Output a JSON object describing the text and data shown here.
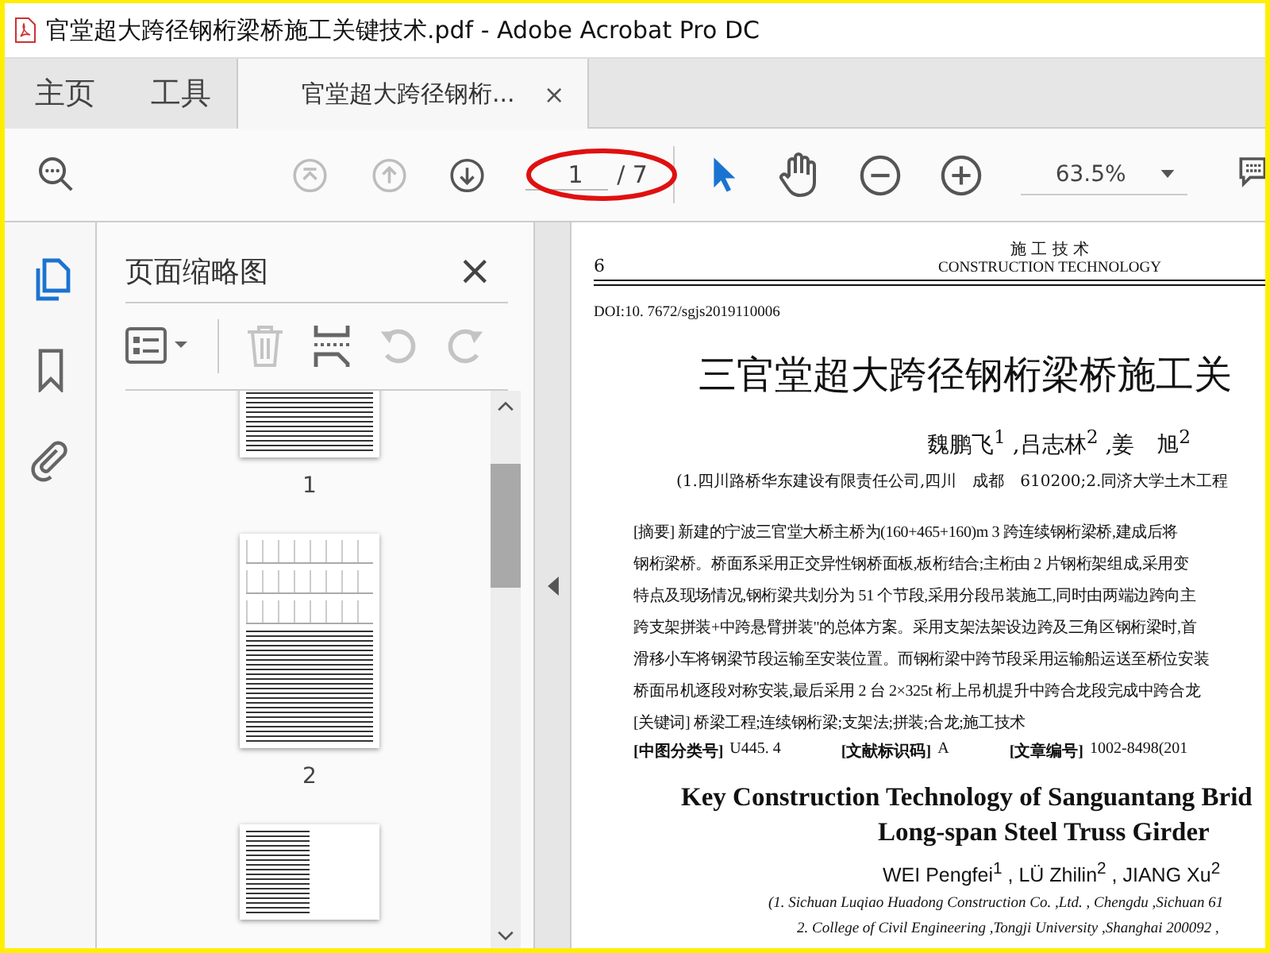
{
  "window": {
    "title": "官堂超大跨径钢桁梁桥施工关键技术.pdf - Adobe Acrobat Pro DC"
  },
  "tabs": [
    {
      "label": "主页",
      "selected": false,
      "kind": "nav"
    },
    {
      "label": "工具",
      "selected": false,
      "kind": "nav"
    },
    {
      "label": "官堂超大跨径钢桁...",
      "selected": true,
      "kind": "document",
      "close": "×"
    }
  ],
  "toolbar": {
    "buttons": [
      {
        "kind": "search"
      },
      {
        "kind": "first",
        "disabled": true
      },
      {
        "kind": "prev",
        "disabled": true
      },
      {
        "kind": "next",
        "disabled": false
      }
    ],
    "page_field": {
      "value": "1",
      "total": "/ 7",
      "circled": true
    },
    "tools": [
      {
        "kind": "select",
        "selected": true
      },
      {
        "kind": "hand",
        "selected": false
      },
      {
        "kind": "zoom-out",
        "selected": false
      },
      {
        "kind": "zoom-in",
        "selected": false
      }
    ],
    "zoom": {
      "value": "63.5%"
    }
  },
  "rail": [
    {
      "kind": "pages",
      "selected": true
    },
    {
      "kind": "bookmark",
      "selected": false
    },
    {
      "kind": "attachment",
      "selected": false
    }
  ],
  "panel": {
    "title": "页面缩略图",
    "close": "×",
    "tools": [
      {
        "kind": "options",
        "disabled": false
      },
      {
        "kind": "delete",
        "disabled": true
      },
      {
        "kind": "extract",
        "disabled": false
      },
      {
        "kind": "rotate-left",
        "disabled": true
      },
      {
        "kind": "rotate-right",
        "disabled": true
      }
    ],
    "thumbnails": [
      {
        "number": "1",
        "kind": "text-end"
      },
      {
        "number": "2",
        "kind": "figures"
      },
      {
        "kind": "text-figure"
      }
    ]
  },
  "document": {
    "header_cn": "施 工 技 术",
    "header_en": "CONSTRUCTION TECHNOLOGY",
    "page_number": "6",
    "doi": "DOI:10. 7672/sgjs2019110006",
    "title_cn": "三官堂超大跨径钢桁梁桥施工关",
    "authors_cn": "魏鹏飞$^{1}$ ,吕志林$^{2}$ ,姜　旭$^{2}$",
    "affiliation_cn": "(1.四川路桥华东建设有限责任公司,四川　成都　610200;2.同济大学土木工程",
    "abstract_lines": [
      "[摘要] 新建的宁波三官堂大桥主桥为(160+465+160)m 3 跨连续钢桁梁桥,建成后将",
      "钢桁梁桥。桥面系采用正交异性钢桥面板,板桁结合;主桁由 2 片钢桁架组成,采用变",
      "特点及现场情况,钢桁梁共划分为 51 个节段,采用分段吊装施工,同时由两端边跨向主",
      "跨支架拼装+中跨悬臂拼装\"的总体方案。采用支架法架设边跨及三角区钢桁梁时,首",
      "滑移小车将钢梁节段运输至安装位置。而钢桁梁中跨节段采用运输船运送至桥位安装",
      "桥面吊机逐段对称安装,最后采用 2 台 2×325t 桁上吊机提升中跨合龙段完成中跨合龙",
      "[关键词] 桥梁工程;连续钢桁梁;支架法;拼装;合龙;施工技术"
    ],
    "classification": [
      {
        "label": "[中图分类号]",
        "value": "U445. 4"
      },
      {
        "label": "[文献标识码]",
        "value": "A"
      },
      {
        "label": "[文章编号]",
        "value": "1002-8498(201"
      }
    ],
    "title_en": [
      "Key Construction Technology of Sanguantang Brid",
      "Long-span Steel Truss Girder"
    ],
    "authors_en": "WEI Pengfei$^{1}$ , LÜ Zhilin$^{2}$ , JIANG Xu$^{2}$",
    "affiliations_en": [
      "(1. Sichuan Luqiao Huadong Construction Co. ,Ltd. , Chengdu ,Sichuan   61",
      "2. College of Civil Engineering ,Tongji University ,Shanghai   200092 ,"
    ]
  }
}
